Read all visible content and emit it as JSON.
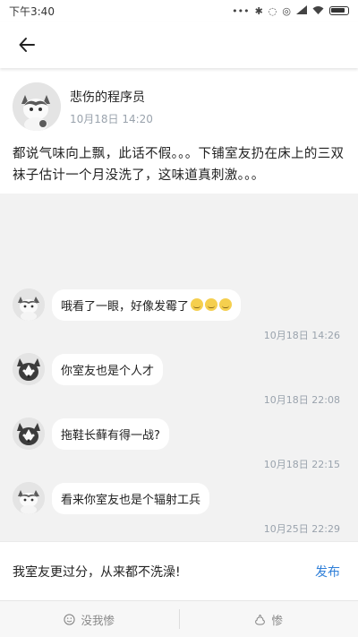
{
  "status_bar": {
    "time": "下午3:40",
    "icons": [
      "signal-dots",
      "bluetooth-icon",
      "mute-icon",
      "alarm-icon",
      "cell-signal-icon",
      "wifi-icon",
      "battery-icon"
    ]
  },
  "header": {
    "back_icon": "arrow-left-icon"
  },
  "post": {
    "author": "悲伤的程序员",
    "time": "10月18日 14:20",
    "body": "都说气味向上飘，此话不假。。。下铺室友扔在床上的三双袜子估计一个月没洗了，这味道真刺激。。。"
  },
  "comments": [
    {
      "avatar": "cat",
      "text": "哦看了一眼，好像发霉了",
      "emoji_count": 3,
      "time": "10月18日 14:26"
    },
    {
      "avatar": "husky",
      "text": "你室友也是个人才",
      "emoji_count": 0,
      "time": "10月18日 22:08"
    },
    {
      "avatar": "husky",
      "text": "拖鞋长藓有得一战?",
      "emoji_count": 0,
      "time": "10月18日 22:15"
    },
    {
      "avatar": "cat",
      "text": "看来你室友也是个辐射工兵",
      "emoji_count": 0,
      "time": "10月25日 22:29"
    }
  ],
  "reply": {
    "value": "我室友更过分，从来都不洗澡!",
    "publish_label": "发布"
  },
  "bottom_bar": {
    "left_label": "没我惨",
    "right_label": "惨"
  },
  "colors": {
    "accent": "#2f7fd8",
    "timestamp": "#9aa3ad",
    "background": "#f2f2f2"
  }
}
